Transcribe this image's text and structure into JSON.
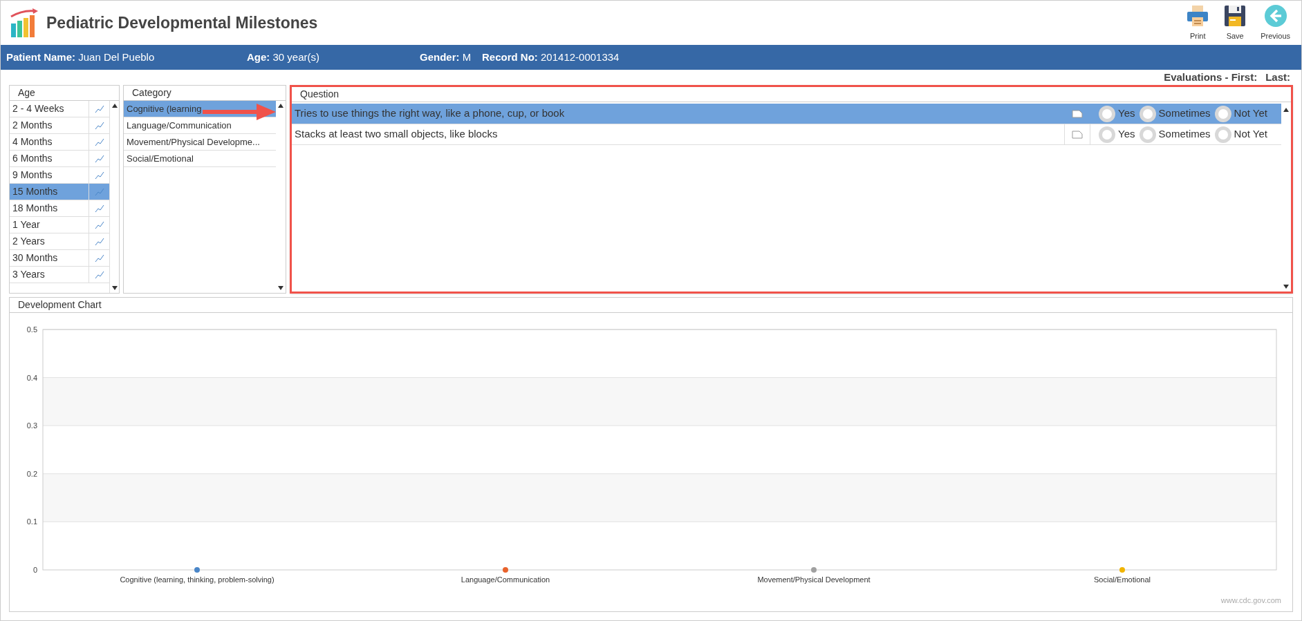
{
  "app": {
    "title": "Pediatric Developmental Milestones"
  },
  "toolbar": [
    {
      "kind": "print",
      "label": "Print"
    },
    {
      "kind": "save",
      "label": "Save"
    },
    {
      "kind": "previous",
      "label": "Previous"
    }
  ],
  "patient": {
    "name_label": "Patient Name:",
    "name": "Juan Del Pueblo",
    "age_label": "Age:",
    "age": "30 year(s)",
    "gender_label": "Gender:",
    "gender": "M",
    "record_label": "Record No:",
    "record": "201412-0001334"
  },
  "evaluations": {
    "first_label": "Evaluations - First:",
    "last_label": "Last:"
  },
  "age_panel": {
    "title": "Age",
    "items": [
      {
        "label": "2 - 4 Weeks",
        "selected": false
      },
      {
        "label": "2 Months",
        "selected": false
      },
      {
        "label": "4 Months",
        "selected": false
      },
      {
        "label": "6 Months",
        "selected": false
      },
      {
        "label": "9 Months",
        "selected": false
      },
      {
        "label": "15 Months",
        "selected": true
      },
      {
        "label": "18 Months",
        "selected": false
      },
      {
        "label": "1 Year",
        "selected": false
      },
      {
        "label": "2 Years",
        "selected": false
      },
      {
        "label": "30 Months",
        "selected": false
      },
      {
        "label": "3 Years",
        "selected": false
      }
    ]
  },
  "category_panel": {
    "title": "Category",
    "items": [
      {
        "label": "Cognitive (learning",
        "selected": true
      },
      {
        "label": "Language/Communication",
        "selected": false
      },
      {
        "label": "Movement/Physical Developme...",
        "selected": false
      },
      {
        "label": "Social/Emotional",
        "selected": false
      }
    ]
  },
  "question_panel": {
    "title": "Question",
    "rows": [
      {
        "text": "Tries to use things the right way, like a phone, cup, or book",
        "selected": true,
        "options": [
          {
            "label": "Yes",
            "checked": false
          },
          {
            "label": "Sometimes",
            "checked": false
          },
          {
            "label": "Not Yet",
            "checked": false
          }
        ]
      },
      {
        "text": "Stacks at least two small objects, like blocks",
        "selected": false,
        "options": [
          {
            "label": "Yes",
            "checked": false
          },
          {
            "label": "Sometimes",
            "checked": false
          },
          {
            "label": "Not Yet",
            "checked": false
          }
        ]
      }
    ]
  },
  "chart_panel": {
    "title": "Development Chart",
    "credit": "www.cdc.gov.com",
    "chart_data": {
      "type": "scatter",
      "categories": [
        "Cognitive (learning, thinking, problem-solving)",
        "Language/Communication",
        "Movement/Physical Development",
        "Social/Emotional"
      ],
      "series": [
        {
          "color": "#4a86c8",
          "values": [
            0,
            null,
            null,
            null
          ]
        },
        {
          "color": "#e8622c",
          "values": [
            null,
            0,
            null,
            null
          ]
        },
        {
          "color": "#a0a0a0",
          "values": [
            null,
            null,
            0,
            null
          ]
        },
        {
          "color": "#f0b400",
          "values": [
            null,
            null,
            null,
            0
          ]
        }
      ],
      "grid": true,
      "ylim": [
        0,
        0.5
      ],
      "yticks": [
        0,
        0.1,
        0.2,
        0.3,
        0.4,
        0.5
      ]
    }
  }
}
